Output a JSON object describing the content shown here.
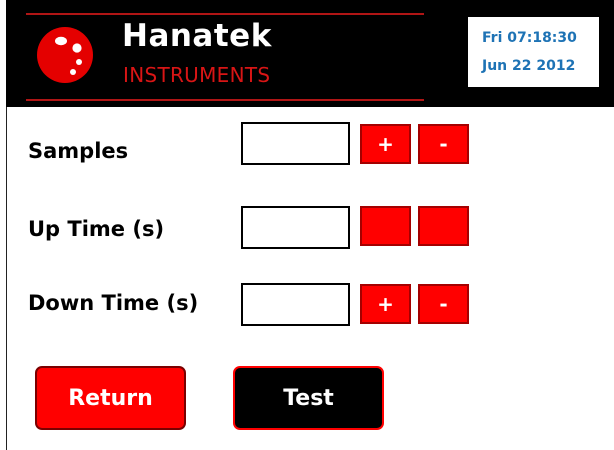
{
  "header": {
    "brand_name": "Hanatek",
    "brand_sub": "INSTRUMENTS",
    "logo_icon": "hanatek-logo",
    "clock_time": "Fri 07:18:30",
    "clock_date": "Jun 22 2012"
  },
  "colors": {
    "accent_red": "#ff0000",
    "header_bg": "#000000",
    "clock_text": "#1e73b5"
  },
  "settings": {
    "samples": {
      "label": "Samples",
      "value": "",
      "plus_label": "+",
      "minus_label": "-"
    },
    "up_time": {
      "label": "Up Time (s)",
      "value": "",
      "plus_label": "",
      "minus_label": ""
    },
    "down_time": {
      "label": "Down Time (s)",
      "value": "",
      "plus_label": "+",
      "minus_label": "-"
    }
  },
  "actions": {
    "return_label": "Return",
    "test_label": "Test"
  }
}
